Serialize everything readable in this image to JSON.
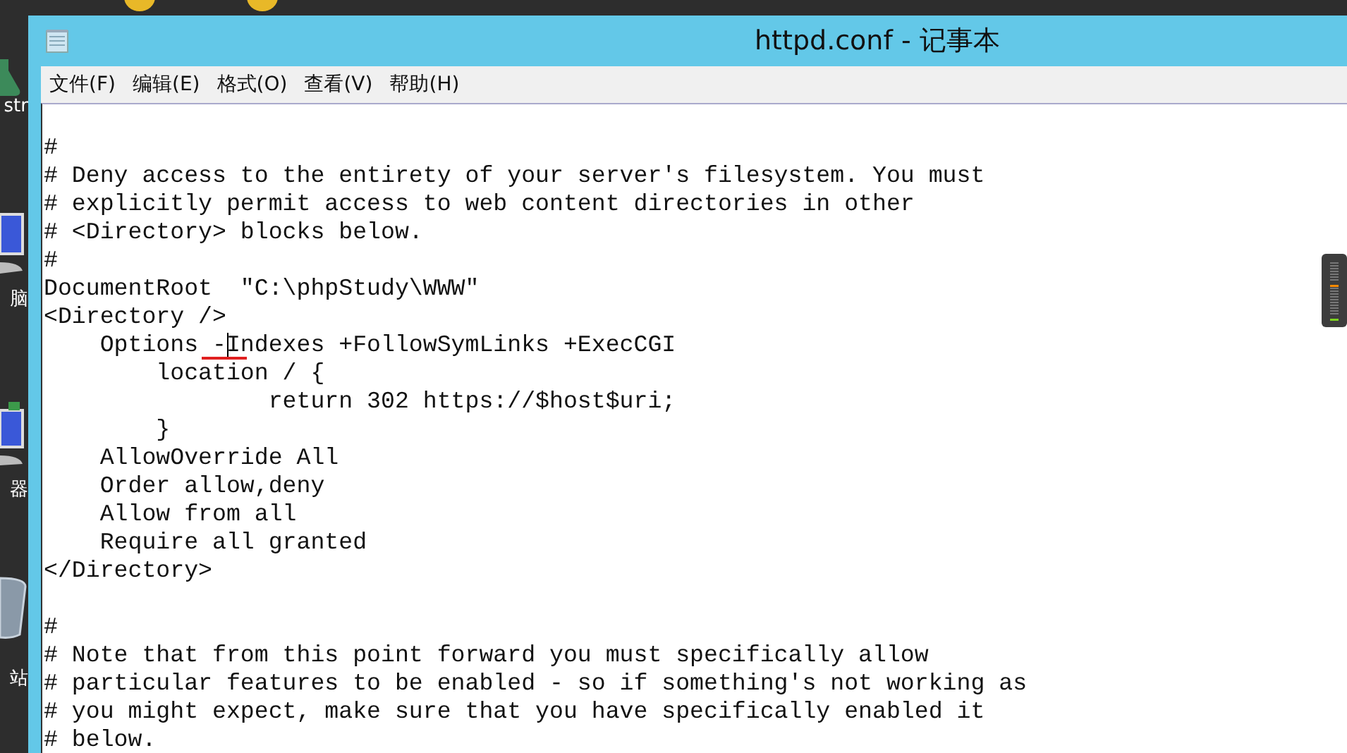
{
  "desktop": {
    "icons": [
      {
        "kind": "app",
        "label": "str"
      },
      {
        "kind": "computer",
        "label": "脑"
      },
      {
        "kind": "network",
        "label": "器"
      },
      {
        "kind": "recycle",
        "label": "站"
      }
    ]
  },
  "window": {
    "title": "httpd.conf - 记事本"
  },
  "menu": [
    "文件(F)",
    "编辑(E)",
    "格式(O)",
    "查看(V)",
    "帮助(H)"
  ],
  "editor": {
    "sections": [
      [
        "#",
        "# Deny access to the entirety of your server's filesystem. You must",
        "# explicitly permit access to web content directories in other",
        "# <Directory> blocks below.",
        "#",
        "DocumentRoot  \"C:\\phpStudy\\WWW\"",
        "<Directory />",
        "    Options -Indexes +FollowSymLinks +ExecCGI",
        "        location / {",
        "                return 302 https://$host$uri;",
        "        }",
        "    AllowOverride All",
        "    Order allow,deny",
        "    Allow from all",
        "    Require all granted",
        "</Directory>"
      ],
      [
        "#",
        "# Note that from this point forward you must specifically allow",
        "# particular features to be enabled - so if something's not working as",
        "# you might expect, make sure that you have specifically enabled it",
        "# below."
      ]
    ]
  }
}
